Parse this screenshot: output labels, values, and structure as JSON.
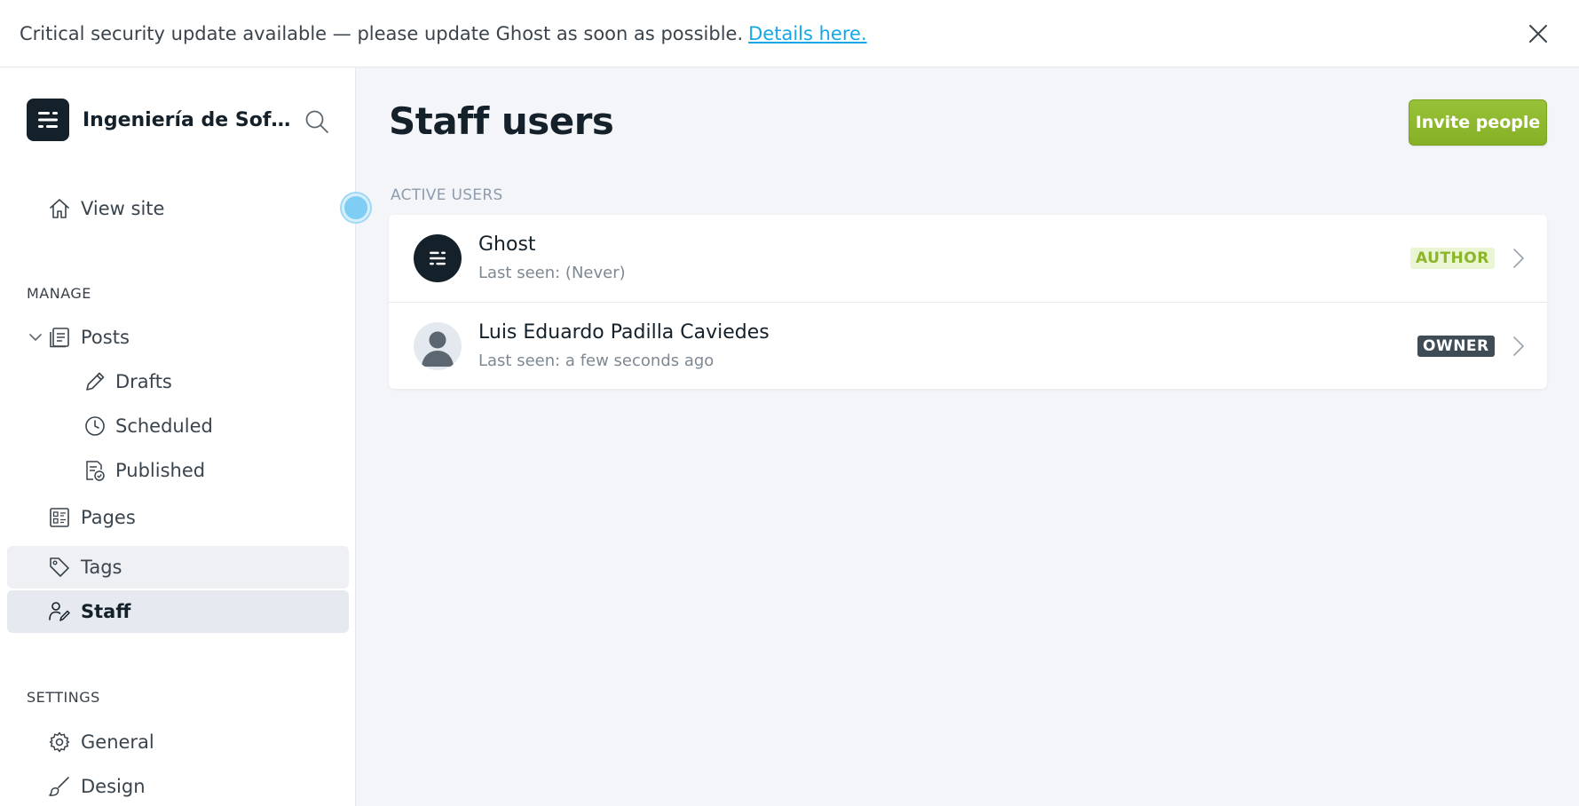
{
  "banner": {
    "message": "Critical security update available — please update Ghost as soon as possible.",
    "link_text": "Details here."
  },
  "sidebar": {
    "site_title": "Ingeniería de Soft...",
    "view_site": "View site",
    "manage_label": "MANAGE",
    "posts": "Posts",
    "drafts": "Drafts",
    "scheduled": "Scheduled",
    "published": "Published",
    "pages": "Pages",
    "tags": "Tags",
    "staff": "Staff",
    "settings_label": "SETTINGS",
    "general": "General",
    "design": "Design"
  },
  "main": {
    "title": "Staff users",
    "invite_button": "Invite people",
    "list_label": "ACTIVE USERS",
    "users": [
      {
        "name": "Ghost",
        "last_seen": "Last seen: (Never)",
        "role": "AUTHOR"
      },
      {
        "name": "Luis Eduardo Padilla Caviedes",
        "last_seen": "Last seen: a few seconds ago",
        "role": "OWNER"
      }
    ]
  },
  "colors": {
    "accent_green": "#86b126",
    "link_blue": "#14a8e8",
    "brand_dark": "#15212a"
  },
  "icons": [
    "close-icon",
    "ghost-logo-icon",
    "search-icon",
    "home-icon",
    "chevron-down-icon",
    "posts-icon",
    "pencil-icon",
    "clock-icon",
    "published-icon",
    "pages-icon",
    "tag-icon",
    "staff-icon",
    "gear-icon",
    "brush-icon",
    "chevron-right-icon"
  ]
}
